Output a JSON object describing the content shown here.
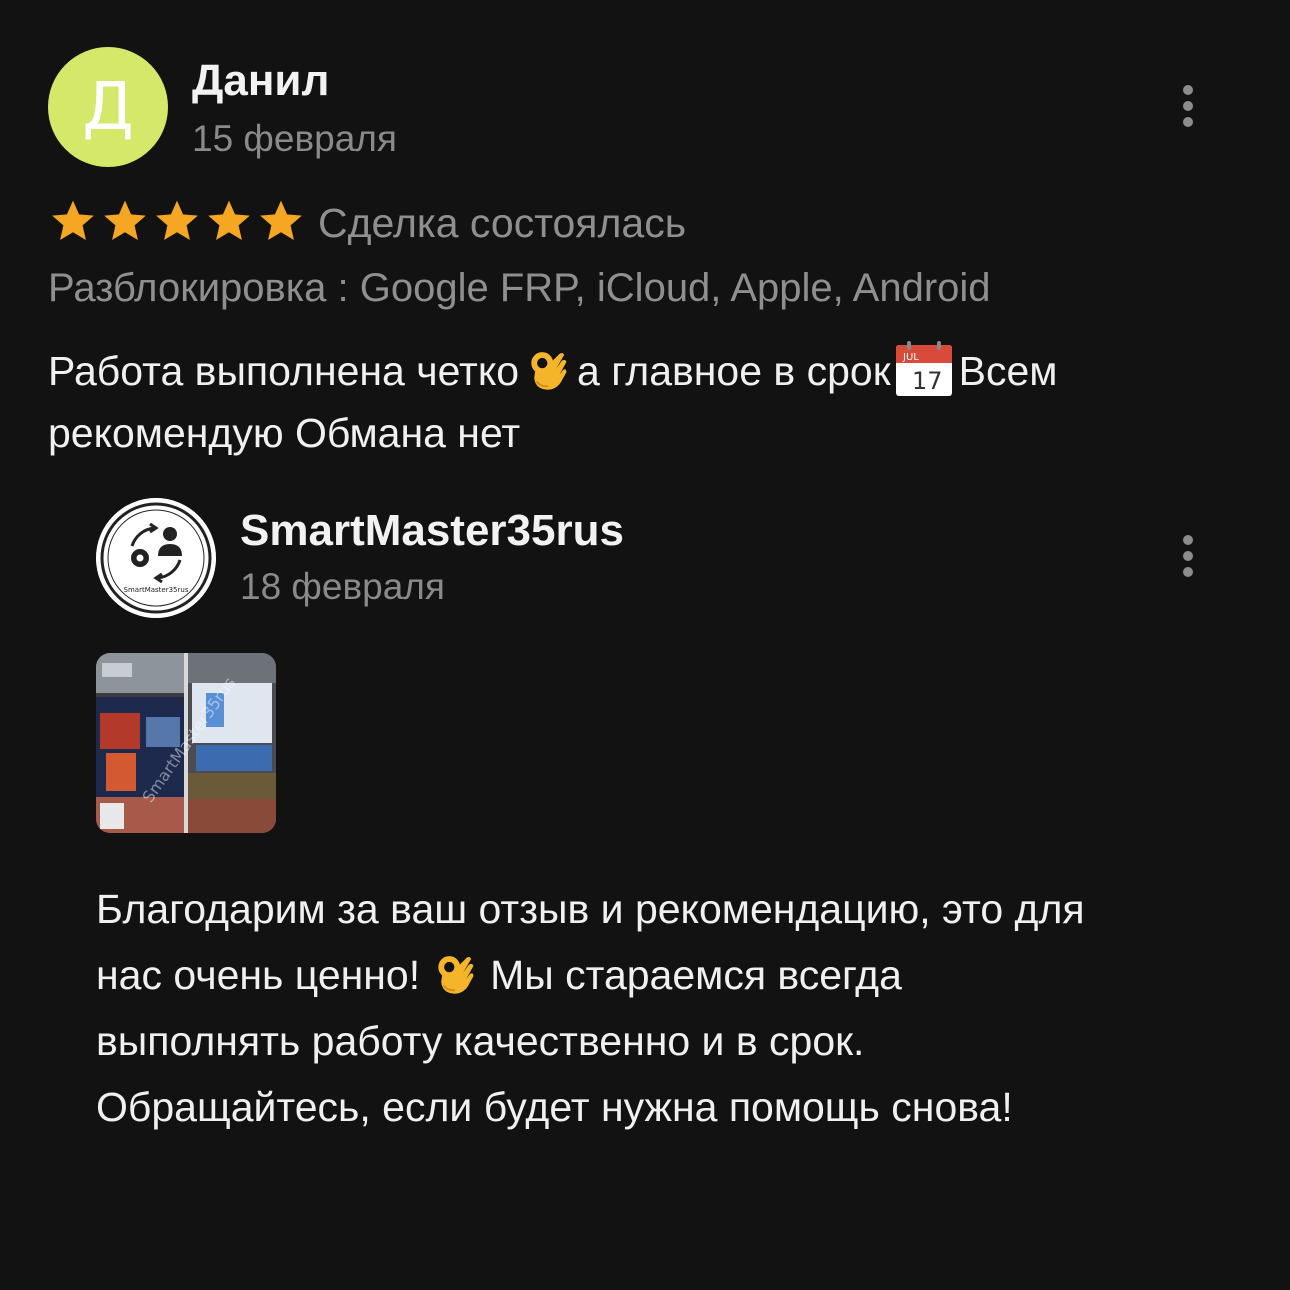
{
  "review": {
    "author": {
      "initial": "Д",
      "name": "Данил",
      "date": "15 февраля",
      "avatar_color": "#d6e86a"
    },
    "rating": 5,
    "star_color": "#f5a623",
    "deal_status": "Сделка состоялась",
    "service": "Разблокировка : Google FRP, iCloud, Apple, Android",
    "text": {
      "line1_a": "Работа выполнена четко",
      "line1_b": "а главное в срок",
      "line1_c": "Всем",
      "line2": "рекомендую Обмана нет"
    },
    "calendar_emoji": {
      "month": "JUL",
      "day": "17"
    }
  },
  "reply": {
    "author": {
      "name": "SmartMaster35rus",
      "date": "18 февраля",
      "logo_text": "SmartMaster35rus"
    },
    "photo_watermark": "SmartMaster35rus",
    "text": {
      "line1": "Благодарим за ваш отзыв и рекомендацию, это для",
      "line2_a": "нас очень ценно!",
      "line2_b": "Мы стараемся всегда",
      "line3": "выполнять работу качественно и в срок.",
      "line4": "Обращайтесь, если будет нужна помощь снова!"
    }
  },
  "icons": {
    "more": "more-vertical-icon",
    "star": "star-icon",
    "ok_hand": "ok-hand-emoji",
    "calendar": "calendar-emoji"
  },
  "colors": {
    "background": "#121212",
    "text_primary": "#f0f0f0",
    "text_secondary": "#8a8a8a"
  }
}
